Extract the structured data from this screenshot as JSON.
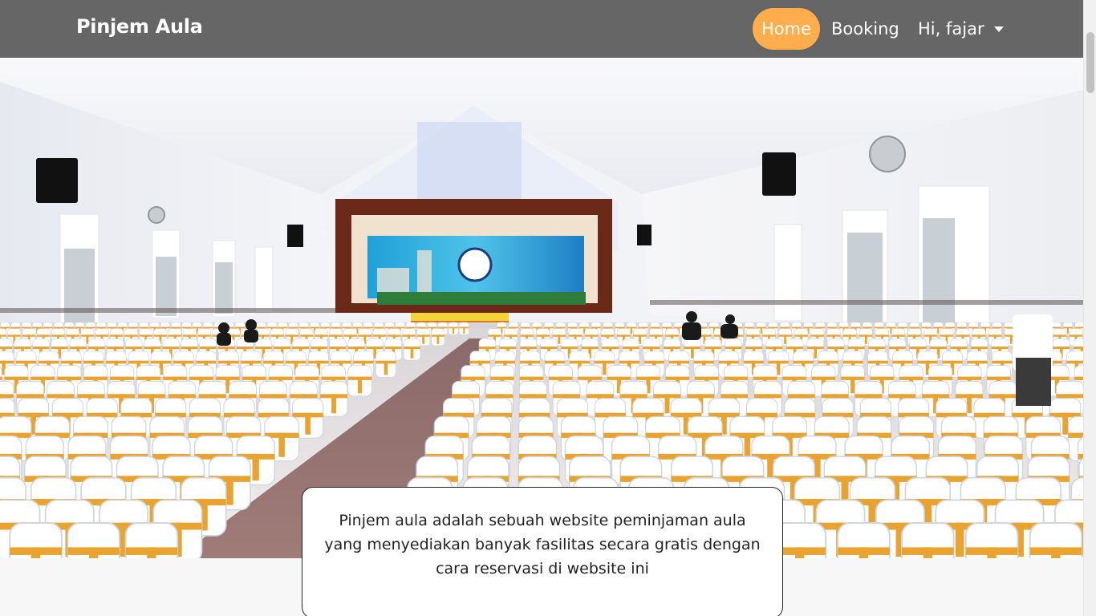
{
  "navbar": {
    "brand": "Pinjem Aula",
    "links": [
      {
        "label": "Home",
        "active": true
      },
      {
        "label": "Booking",
        "active": false
      }
    ],
    "user_menu": "Hi, fajar"
  },
  "hero": {
    "image": "auditorium-hall-photo",
    "caption": "Pinjem aula adalah sebuah website peminjaman aula yang menyediakan banyak fasilitas secara gratis dengan cara reservasi di website ini"
  },
  "colors": {
    "navbar_bg": "#666666",
    "active_pill": "#ffad4d",
    "chair_cover": "#ffffff",
    "chair_sash": "#e8a331",
    "stage_backdrop": "#2aa6d8"
  }
}
